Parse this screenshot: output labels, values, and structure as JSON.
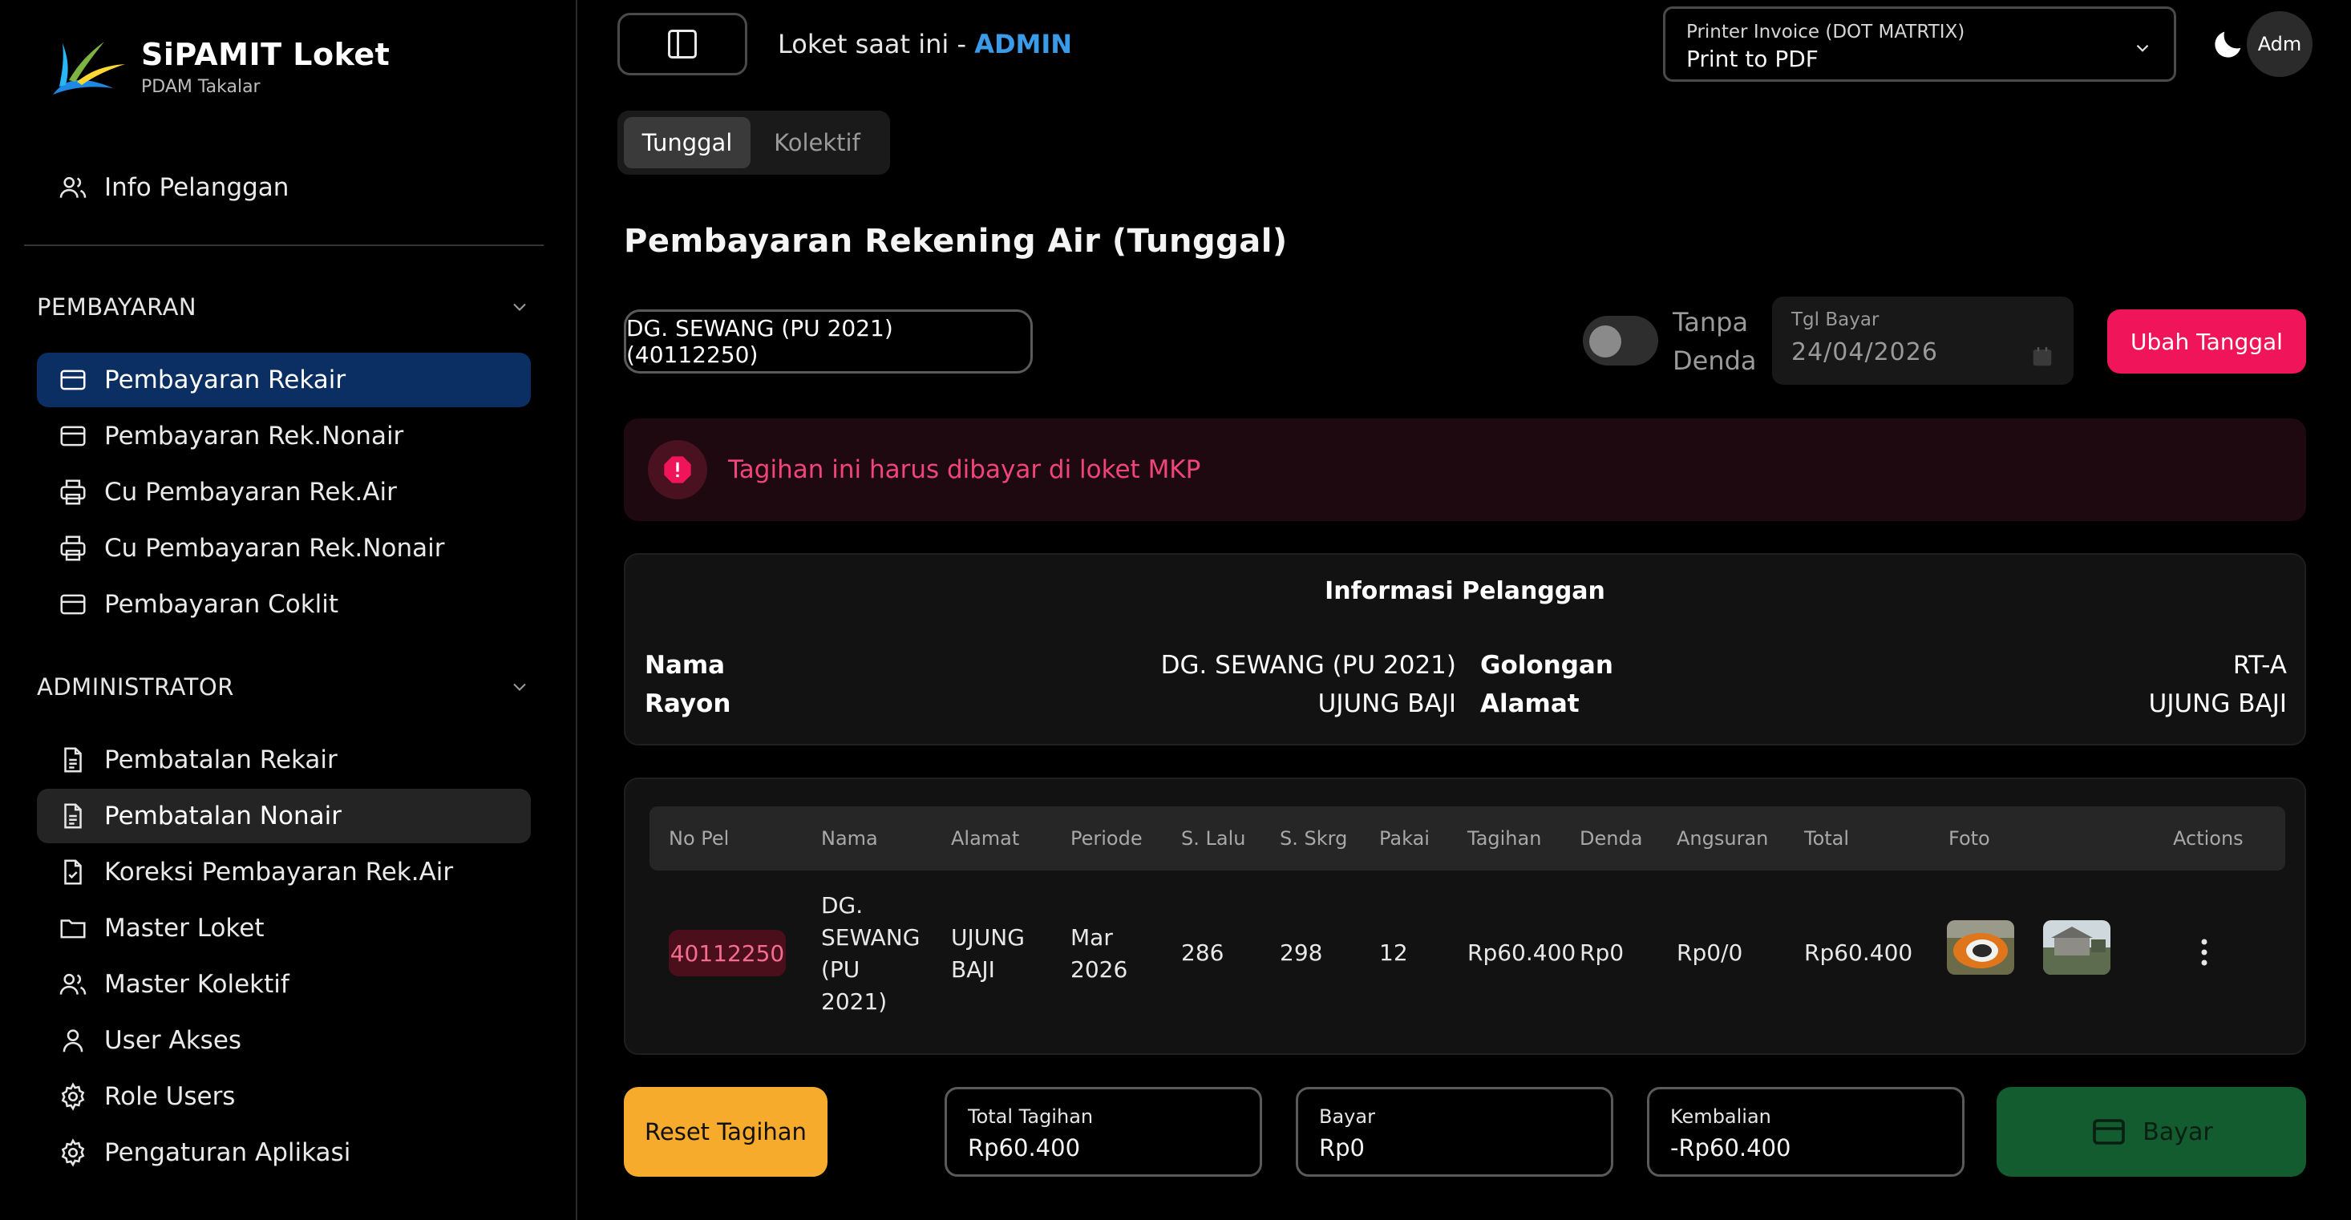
{
  "brand": {
    "title": "SiPAMIT Loket",
    "subtitle": "PDAM Takalar"
  },
  "sidebar": {
    "top_item": "Info Pelanggan",
    "pembayaran": {
      "heading": "PEMBAYARAN",
      "items": [
        "Pembayaran Rekair",
        "Pembayaran Rek.Nonair",
        "Cu Pembayaran Rek.Air",
        "Cu Pembayaran Rek.Nonair",
        "Pembayaran Coklit"
      ]
    },
    "administrator": {
      "heading": "ADMINISTRATOR",
      "items": [
        "Pembatalan Rekair",
        "Pembatalan Nonair",
        "Koreksi Pembayaran Rek.Air",
        "Master Loket",
        "Master Kolektif",
        "User Akses",
        "Role Users",
        "Pengaturan Aplikasi"
      ]
    }
  },
  "topbar": {
    "counter_prefix": "Loket saat ini - ",
    "counter_name": "ADMIN",
    "printer_label": "Printer Invoice (DOT MATRTIX)",
    "printer_value": "Print to PDF",
    "avatar": "Adm"
  },
  "tabs": [
    "Tunggal",
    "Kolektif"
  ],
  "page_title": "Pembayaran Rekening Air (Tunggal)",
  "customer_select": "DG. SEWANG (PU 2021) (40112250)",
  "tanpa_denda": {
    "line1": "Tanpa",
    "line2": "Denda"
  },
  "tgl_bayar": {
    "label": "Tgl Bayar",
    "value": "24/04/2026"
  },
  "ubah_tanggal": "Ubah Tanggal",
  "alert": "Tagihan ini harus dibayar di loket MKP",
  "info": {
    "title": "Informasi Pelanggan",
    "nama_label": "Nama",
    "nama_value": "DG. SEWANG (PU 2021)",
    "rayon_label": "Rayon",
    "rayon_value": "UJUNG BAJI",
    "golongan_label": "Golongan",
    "golongan_value": "RT-A",
    "alamat_label": "Alamat",
    "alamat_value": "UJUNG BAJI"
  },
  "table": {
    "headers": [
      "No Pel",
      "Nama",
      "Alamat",
      "Periode",
      "S. Lalu",
      "S. Skrg",
      "Pakai",
      "Tagihan",
      "Denda",
      "Angsuran",
      "Total",
      "Foto",
      "Actions"
    ],
    "row": {
      "nopel": "40112250",
      "nama_lines": [
        "DG.",
        "SEWANG",
        "(PU",
        "2021)"
      ],
      "alamat_lines": [
        "UJUNG",
        "BAJI"
      ],
      "periode_lines": [
        "Mar",
        "2026"
      ],
      "s_lalu": "286",
      "s_skrg": "298",
      "pakai": "12",
      "tagihan": "Rp60.400",
      "denda": "Rp0",
      "angsuran": "Rp0/0",
      "total": "Rp60.400"
    }
  },
  "footer": {
    "reset": "Reset Tagihan",
    "total_tagihan_label": "Total Tagihan",
    "total_tagihan_value": "Rp60.400",
    "bayar_label": "Bayar",
    "bayar_value": "Rp0",
    "kembalian_label": "Kembalian",
    "kembalian_value": "-Rp60.400",
    "pay_button": "Bayar"
  },
  "colors": {
    "accent_blue": "#3a9be8",
    "active_nav": "#0b2f63",
    "danger": "#f0145a",
    "warning": "#f6ab2c",
    "success": "#125c30"
  }
}
